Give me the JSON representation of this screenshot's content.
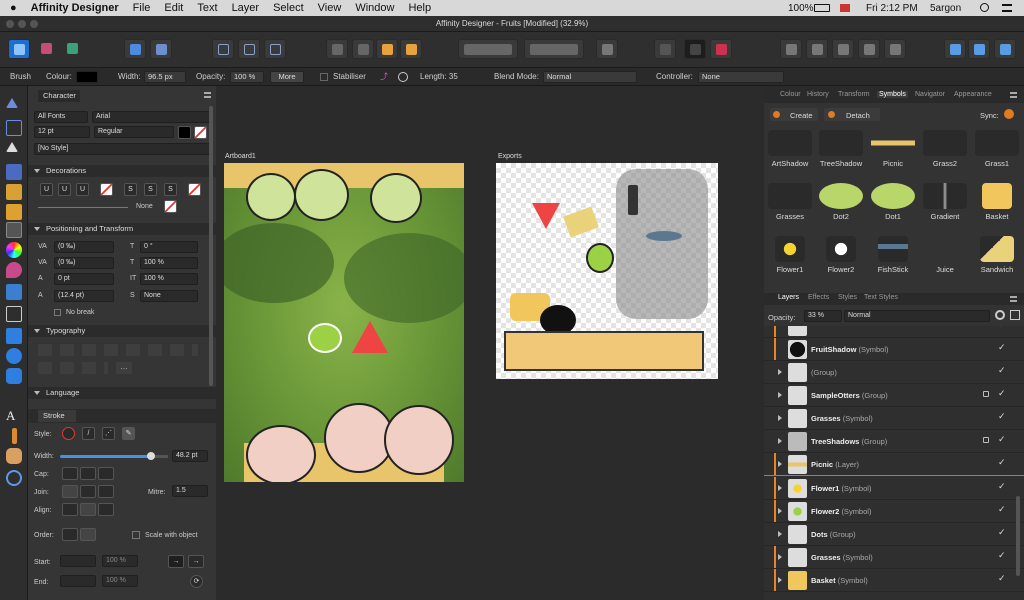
{
  "menubar": {
    "app": "Affinity Designer",
    "items": [
      "File",
      "Edit",
      "Text",
      "Layer",
      "Select",
      "View",
      "Window",
      "Help"
    ],
    "battery": "100%",
    "datetime": "Fri 2:12 PM",
    "user": "5argon"
  },
  "window": {
    "title": "Affinity Designer - Fruits [Modified] (32.9%)"
  },
  "context": {
    "tool": "Brush",
    "colour_label": "Colour:",
    "width_label": "Width:",
    "width_value": "96.5 px",
    "opacity_label": "Opacity:",
    "opacity_value": "100 %",
    "more": "More",
    "stabiliser": "Stabiliser",
    "length_label": "Length: 35",
    "blend_label": "Blend Mode:",
    "blend_value": "Normal",
    "controller_label": "Controller:",
    "controller_value": "None"
  },
  "character": {
    "title": "Character",
    "collection": "All Fonts",
    "font": "Arial",
    "size": "12 pt",
    "style": "Regular",
    "paragraph_style": "[No Style]"
  },
  "decorations": {
    "title": "Decorations",
    "none": "None"
  },
  "positioning": {
    "title": "Positioning and Transform",
    "tracking": "(0 ‰)",
    "angle": "0 °",
    "kerning": "(0 ‰)",
    "hscale": "100 %",
    "baseline": "0 pt",
    "vscale": "100 %",
    "leading": "(12.4 pt)",
    "shear": "None",
    "no_break": "No break"
  },
  "typography": {
    "title": "Typography"
  },
  "language": {
    "title": "Language"
  },
  "stroke": {
    "title": "Stroke",
    "style_label": "Style:",
    "width_label": "Width:",
    "width_value": "48.2 pt",
    "cap_label": "Cap:",
    "join_label": "Join:",
    "mitre_label": "Mitre:",
    "mitre_value": "1.5",
    "align_label": "Align:",
    "order_label": "Order:",
    "scale_label": "Scale with object",
    "start_label": "Start:",
    "end_label": "End:",
    "start_pct": "100 %",
    "end_pct": "100 %"
  },
  "artboards": {
    "a1": "Artboard1",
    "a2": "Exports"
  },
  "right_tabs": [
    "Colour",
    "History",
    "Transform",
    "Symbols",
    "Navigator",
    "Appearance"
  ],
  "symbols": {
    "create": "Create",
    "detach": "Detach",
    "sync": "Sync:",
    "items": [
      "ArtShadow",
      "TreeShadow",
      "Picnic",
      "Grass2",
      "Grass1",
      "Grasses",
      "Dot2",
      "Dot1",
      "Gradient",
      "Basket",
      "Flower1",
      "Flower2",
      "FishStick",
      "Juice",
      "Sandwich"
    ]
  },
  "layer_tabs": [
    "Layers",
    "Effects",
    "Styles",
    "Text Styles"
  ],
  "layers_opacity": {
    "label": "Opacity:",
    "value": "33 %",
    "blend": "Normal"
  },
  "layers": [
    {
      "name": "FruitShadow",
      "type": "(Symbol)"
    },
    {
      "name": "",
      "type": "(Group)"
    },
    {
      "name": "SampleOtters",
      "type": "(Group)"
    },
    {
      "name": "Grasses",
      "type": "(Symbol)"
    },
    {
      "name": "TreeShadows",
      "type": "(Group)"
    },
    {
      "name": "Picnic",
      "type": "(Layer)"
    },
    {
      "name": "Flower1",
      "type": "(Symbol)"
    },
    {
      "name": "Flower2",
      "type": "(Symbol)"
    },
    {
      "name": "Dots",
      "type": "(Group)"
    },
    {
      "name": "Grasses",
      "type": "(Symbol)"
    },
    {
      "name": "Basket",
      "type": "(Symbol)"
    }
  ],
  "check": "✓"
}
